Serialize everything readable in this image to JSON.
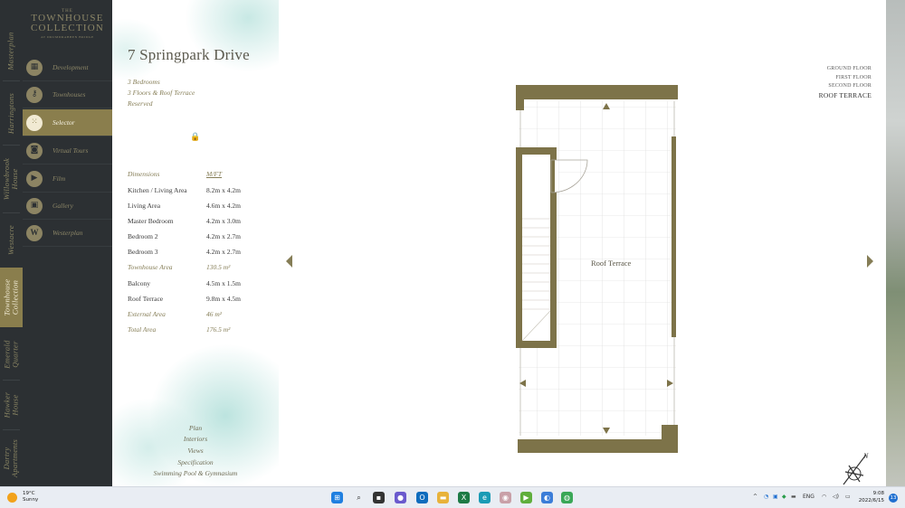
{
  "brand": {
    "small": "THE",
    "line1": "TOWNHOUSE",
    "line2": "COLLECTION",
    "tag": "AT DRUMDRABBEN BRIDGE"
  },
  "side_tabs": [
    {
      "label": "Masterplan",
      "active": false
    },
    {
      "label": "Harringtons",
      "active": false
    },
    {
      "label": "Willowbrook House",
      "active": false
    },
    {
      "label": "Westacre",
      "active": false
    },
    {
      "label": "Townhouse Collection",
      "active": true
    },
    {
      "label": "Emerald Quarter",
      "active": false
    },
    {
      "label": "Hawker House",
      "active": false
    },
    {
      "label": "Dartry Apartments",
      "active": false
    }
  ],
  "menu": [
    {
      "label": "Development",
      "icon": "building-icon",
      "active": false
    },
    {
      "label": "Townhouses",
      "icon": "key-icon",
      "active": false
    },
    {
      "label": "Selector",
      "icon": "grid-icon",
      "active": true
    },
    {
      "label": "Virtual Tours",
      "icon": "vr-headset-icon",
      "active": false
    },
    {
      "label": "Film",
      "icon": "film-icon",
      "active": false
    },
    {
      "label": "Gallery",
      "icon": "gallery-icon",
      "active": false
    },
    {
      "label": "Westerplan",
      "icon": "w-logo-icon",
      "active": false
    }
  ],
  "unit": {
    "title": "7 Springpark Drive",
    "bedrooms": "3 Bedrooms",
    "floors": "3 Floors & Roof Terrace",
    "status": "Reserved"
  },
  "specs": {
    "header": {
      "name": "Dimensions",
      "value": "M/FT"
    },
    "rows": [
      {
        "name": "Kitchen / Living Area",
        "value": "8.2m x 4.2m",
        "highlight": false
      },
      {
        "name": "Living Area",
        "value": "4.6m x 4.2m",
        "highlight": false
      },
      {
        "name": "Master Bedroom",
        "value": "4.2m x 3.0m",
        "highlight": false
      },
      {
        "name": "Bedroom 2",
        "value": "4.2m x 2.7m",
        "highlight": false
      },
      {
        "name": "Bedroom 3",
        "value": "4.2m x 2.7m",
        "highlight": false
      },
      {
        "name": "Townhouse Area",
        "value": "130.5 m²",
        "highlight": true
      },
      {
        "name": "Balcony",
        "value": "4.5m x 1.5m",
        "highlight": false
      },
      {
        "name": "Roof Terrace",
        "value": "9.8m x 4.5m",
        "highlight": false
      },
      {
        "name": "External Area",
        "value": "46 m²",
        "highlight": true
      },
      {
        "name": "Total Area",
        "value": "176.5 m²",
        "highlight": true
      }
    ]
  },
  "links": [
    "Plan",
    "Interiors",
    "Views",
    "Specification",
    "Swimming Pool & Gymnasium"
  ],
  "floor_selector": [
    {
      "label": "GROUND FLOOR",
      "active": false
    },
    {
      "label": "FIRST FLOOR",
      "active": false
    },
    {
      "label": "SECOND FLOOR",
      "active": false
    },
    {
      "label": "ROOF TERRACE",
      "active": true
    }
  ],
  "plan": {
    "room_label": "Roof Terrace",
    "wall_color": "#7d7349"
  },
  "compass_label": "N",
  "taskbar": {
    "temperature": "19°C",
    "condition": "Sunny",
    "language": "ENG",
    "time": "9:08",
    "date": "2022/6/15",
    "notifications": "13"
  },
  "colors": {
    "panel": "#2c3033",
    "accent": "#8a7e4d",
    "gold_text": "#857d56"
  }
}
